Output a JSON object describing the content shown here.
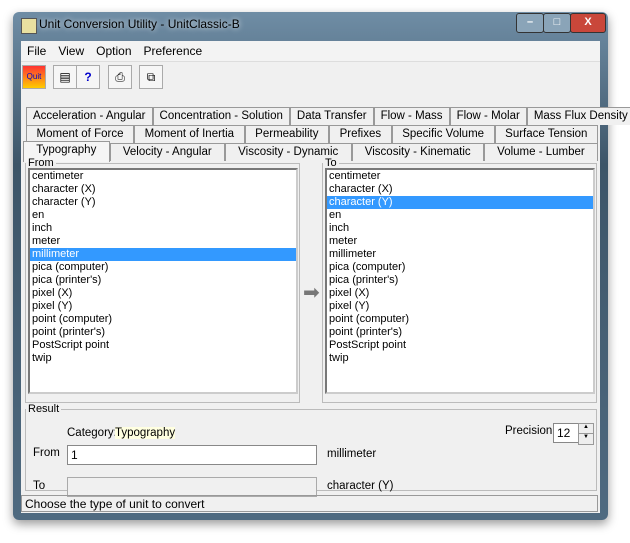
{
  "window": {
    "title": "Unit Conversion Utility - UnitClassic-B",
    "minimize": "–",
    "maximize": "□",
    "close": "X"
  },
  "menu": [
    "File",
    "View",
    "Option",
    "Preference"
  ],
  "toolbar": {
    "quit": "Quit",
    "help": "?"
  },
  "tabs": {
    "row1": [
      "Acceleration - Angular",
      "Concentration - Solution",
      "Data Transfer",
      "Flow - Mass",
      "Flow - Molar",
      "Mass Flux Density"
    ],
    "row2": [
      "Moment of Force",
      "Moment of Inertia",
      "Permeability",
      "Prefixes",
      "Specific Volume",
      "Surface Tension"
    ],
    "row3": [
      "Typography",
      "Velocity - Angular",
      "Viscosity - Dynamic",
      "Viscosity - Kinematic",
      "Volume - Lumber"
    ],
    "active": "Typography"
  },
  "from": {
    "label": "From",
    "selected": "millimeter"
  },
  "to": {
    "label": "To",
    "selected": "character (Y)"
  },
  "units": [
    "centimeter",
    "character (X)",
    "character (Y)",
    "en",
    "inch",
    "meter",
    "millimeter",
    "pica (computer)",
    "pica (printer's)",
    "pixel (X)",
    "pixel (Y)",
    "point (computer)",
    "point (printer's)",
    "PostScript point",
    "twip"
  ],
  "result": {
    "label": "Result",
    "category_label": "Category:",
    "category": "Typography",
    "precision_label": "Precision",
    "precision": "12",
    "from_label": "From",
    "from_value": "1",
    "from_unit": "millimeter",
    "to_label": "To",
    "to_value": "",
    "to_unit": "character (Y)"
  },
  "status": "Choose the type of unit to convert"
}
